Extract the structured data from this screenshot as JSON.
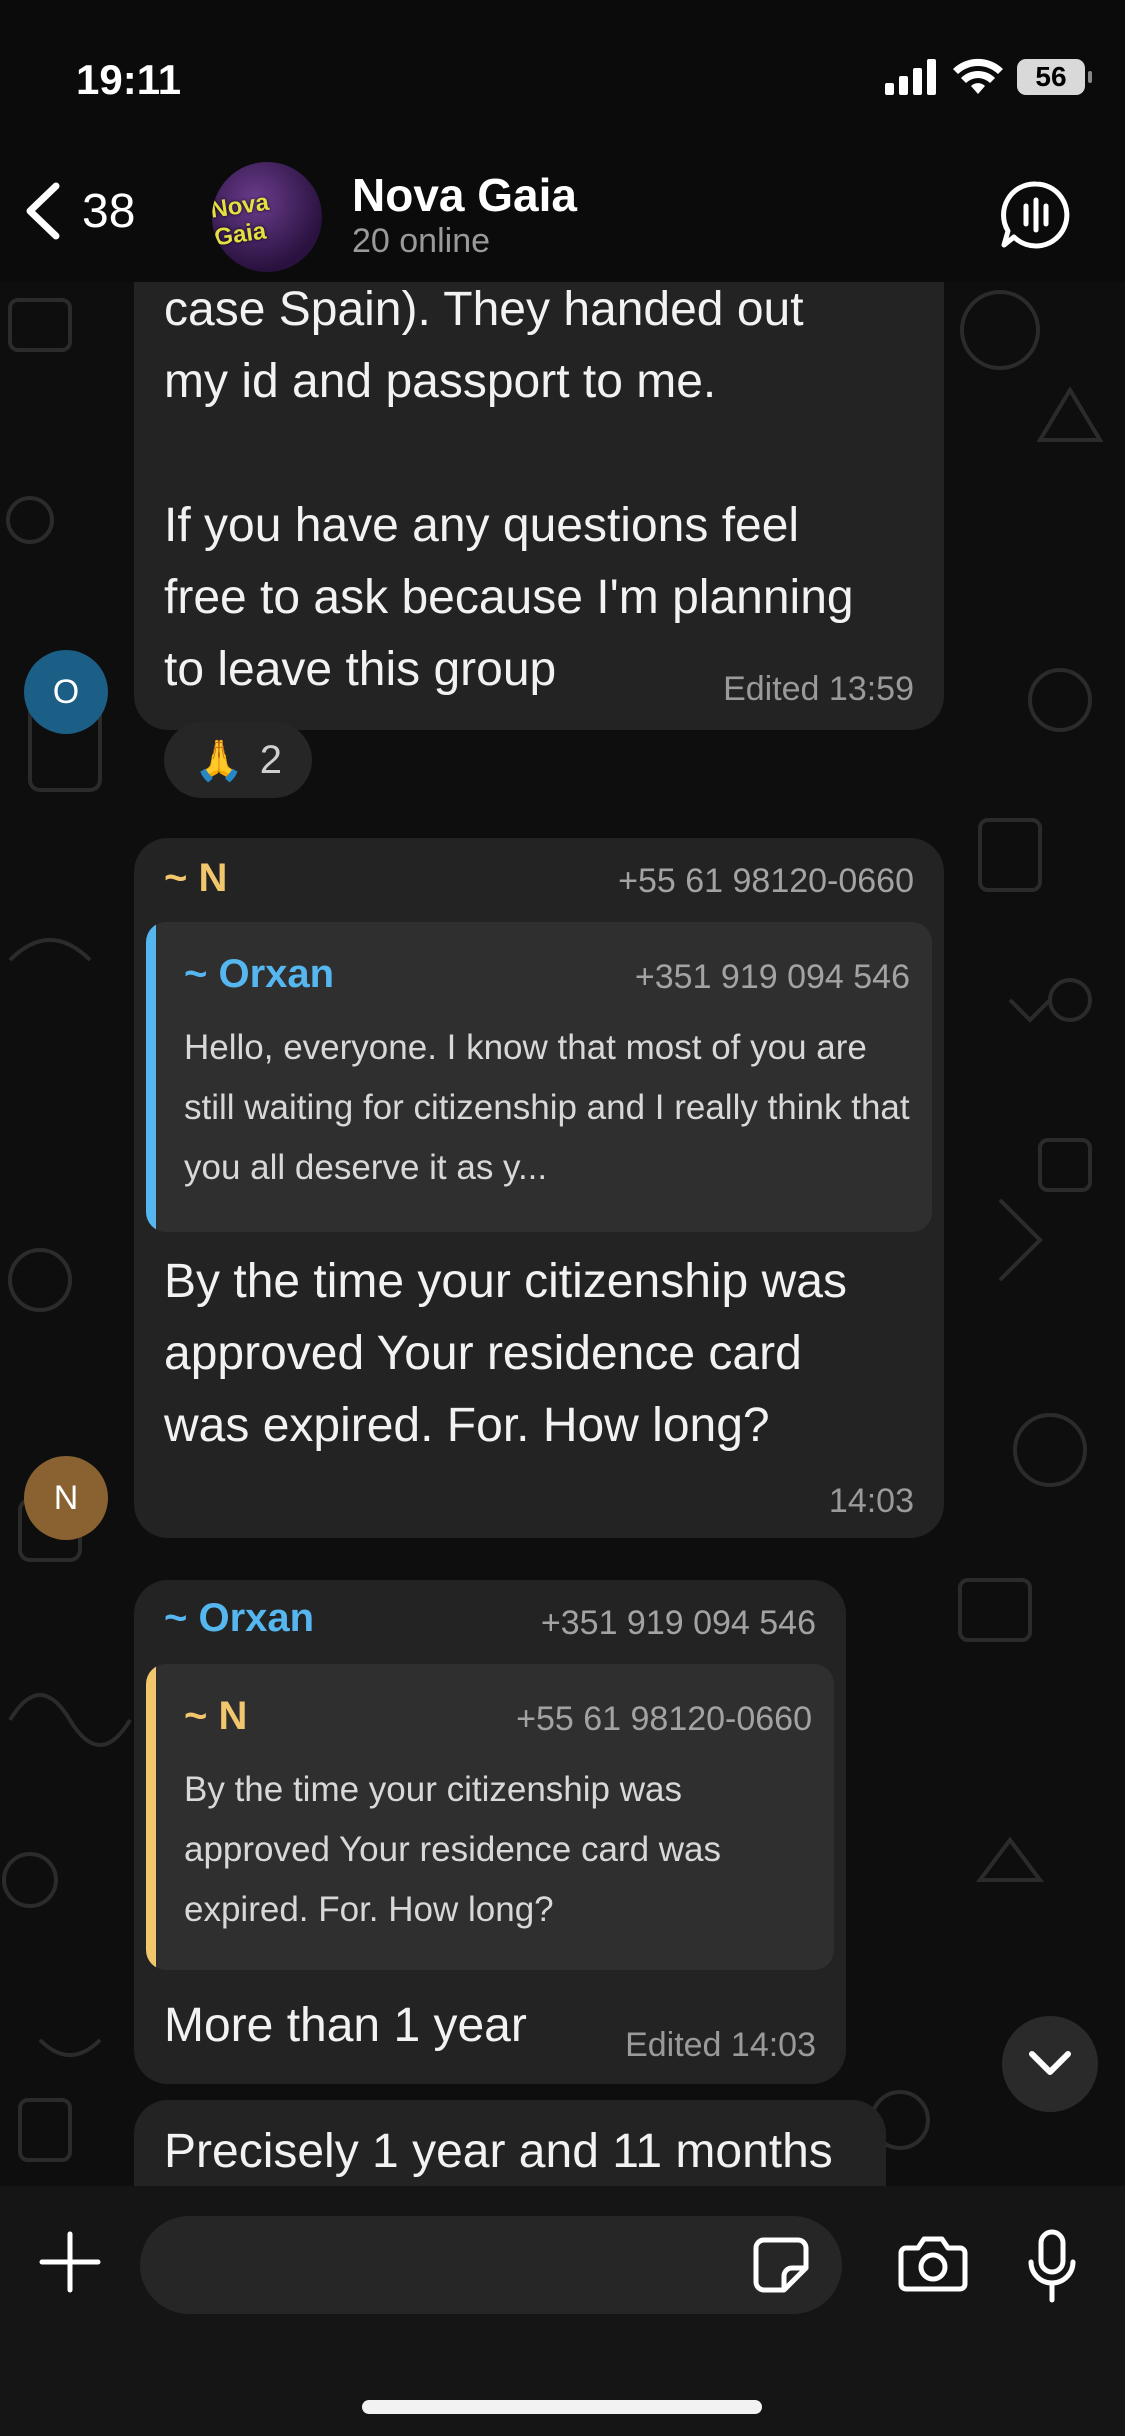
{
  "status_bar": {
    "time": "19:11",
    "battery": "56",
    "icons": [
      "cellular-signal-icon",
      "wifi-icon",
      "battery-icon"
    ]
  },
  "header": {
    "back_count": "38",
    "group_name": "Nova Gaia",
    "subtitle": "20 online",
    "avatar_text": "Nova Gaia",
    "icons": [
      "chevron-left-icon",
      "voice-chat-icon"
    ]
  },
  "messages": [
    {
      "author_initial": "O",
      "text": "case Spain). They handed out\nmy id and passport to me.\n\nIf you have any questions feel\nfree to ask because I'm planning\nto leave this group",
      "meta": "Edited 13:59",
      "reaction": {
        "emoji": "🙏",
        "count": "2"
      }
    },
    {
      "author_initial": "N",
      "sender": "~ N",
      "phone": "+55 61 98120-0660",
      "quote": {
        "sender": "~ Orxan",
        "phone": "+351 919 094 546",
        "text": "Hello, everyone. I know that most of you are still waiting for citizenship and I really think that you all deserve it as y..."
      },
      "text": "By the time your citizenship was\napproved Your residence card\nwas expired. For. How long?",
      "meta": "14:03"
    },
    {
      "sender": "~ Orxan",
      "phone": "+351 919 094 546",
      "quote": {
        "sender": "~ N",
        "phone": "+55 61 98120-0660",
        "text": "By the time your citizenship was approved Your residence card was expired. For. How long?"
      },
      "text": "More than 1 year",
      "meta": "Edited 14:03"
    },
    {
      "text": "Precisely 1 year and 11 months"
    }
  ],
  "colors": {
    "background": "#0e0e0e",
    "bubble": "#232323",
    "quote_background": "#2f2f2f",
    "sender_n": "#f2c66d",
    "sender_orxan": "#55b6f0",
    "avatar_o": "#1b5e86",
    "avatar_n": "#8a6232"
  },
  "input_bar": {
    "placeholder": "",
    "icons": [
      "plus-icon",
      "sticker-icon",
      "camera-icon",
      "microphone-icon"
    ]
  }
}
